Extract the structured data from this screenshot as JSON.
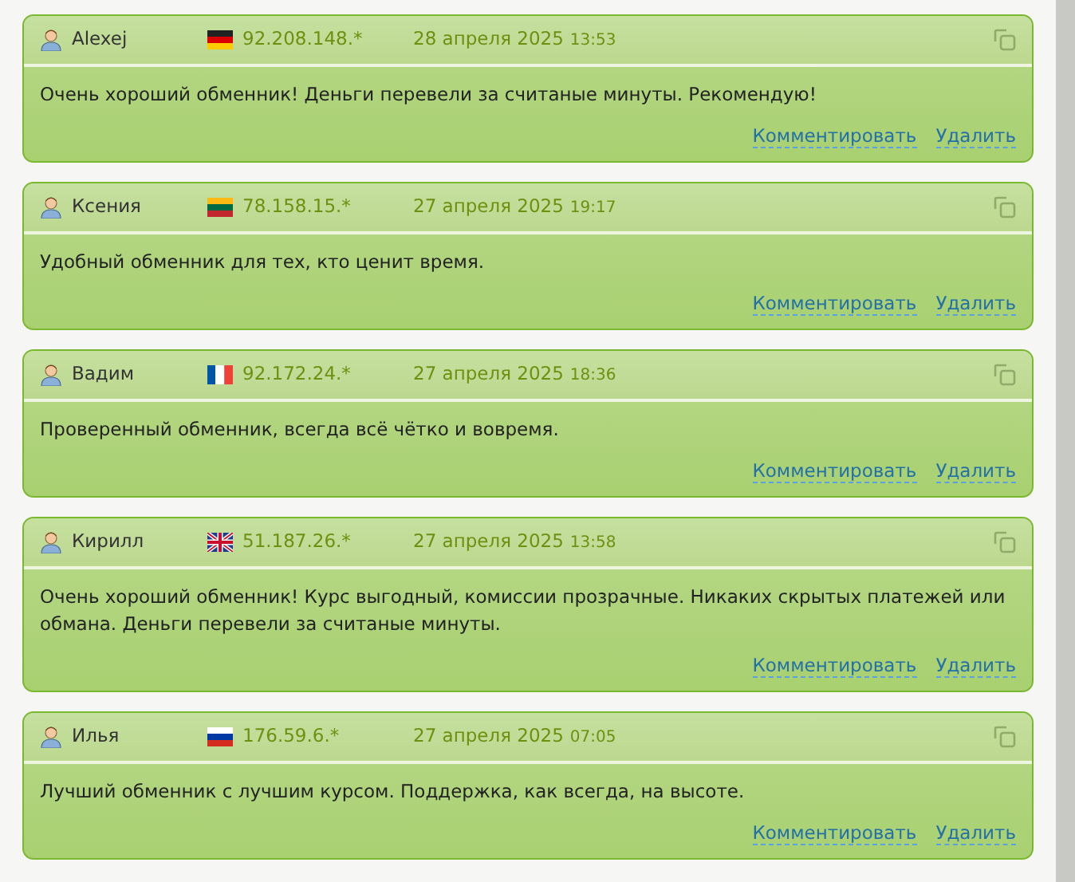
{
  "reviews": [
    {
      "author": "Alexej",
      "flag": {
        "kind": "de"
      },
      "ip": "92.208.148.*",
      "date": "28 апреля 2025",
      "time": "13:53",
      "text": "Очень хороший обменник! Деньги перевели за считаные минуты. Рекомендую!",
      "actions": [
        "Комментировать",
        "Удалить"
      ]
    },
    {
      "author": "Ксения",
      "flag": {
        "kind": "lt"
      },
      "ip": "78.158.15.*",
      "date": "27 апреля 2025",
      "time": "19:17",
      "text": "Удобный обменник для тех, кто ценит время.",
      "actions": [
        "Комментировать",
        "Удалить"
      ]
    },
    {
      "author": "Вадим",
      "flag": {
        "kind": "fr"
      },
      "ip": "92.172.24.*",
      "date": "27 апреля 2025",
      "time": "18:36",
      "text": "Проверенный обменник, всегда всё чётко и вовремя.",
      "actions": [
        "Комментировать",
        "Удалить"
      ]
    },
    {
      "author": "Кирилл",
      "flag": {
        "kind": "gb"
      },
      "ip": "51.187.26.*",
      "date": "27 апреля 2025",
      "time": "13:58",
      "text": "Очень хороший обменник! Курс выгодный, комиссии прозрачные. Никаких скрытых платежей или обмана. Деньги перевели за считаные минуты.",
      "actions": [
        "Комментировать",
        "Удалить"
      ]
    },
    {
      "author": "Илья",
      "flag": {
        "kind": "ru"
      },
      "ip": "176.59.6.*",
      "date": "27 апреля 2025",
      "time": "07:05",
      "text": "Лучший обменник с лучшим курсом. Поддержка, как всегда, на высоте.",
      "actions": [
        "Комментировать",
        "Удалить"
      ]
    }
  ]
}
